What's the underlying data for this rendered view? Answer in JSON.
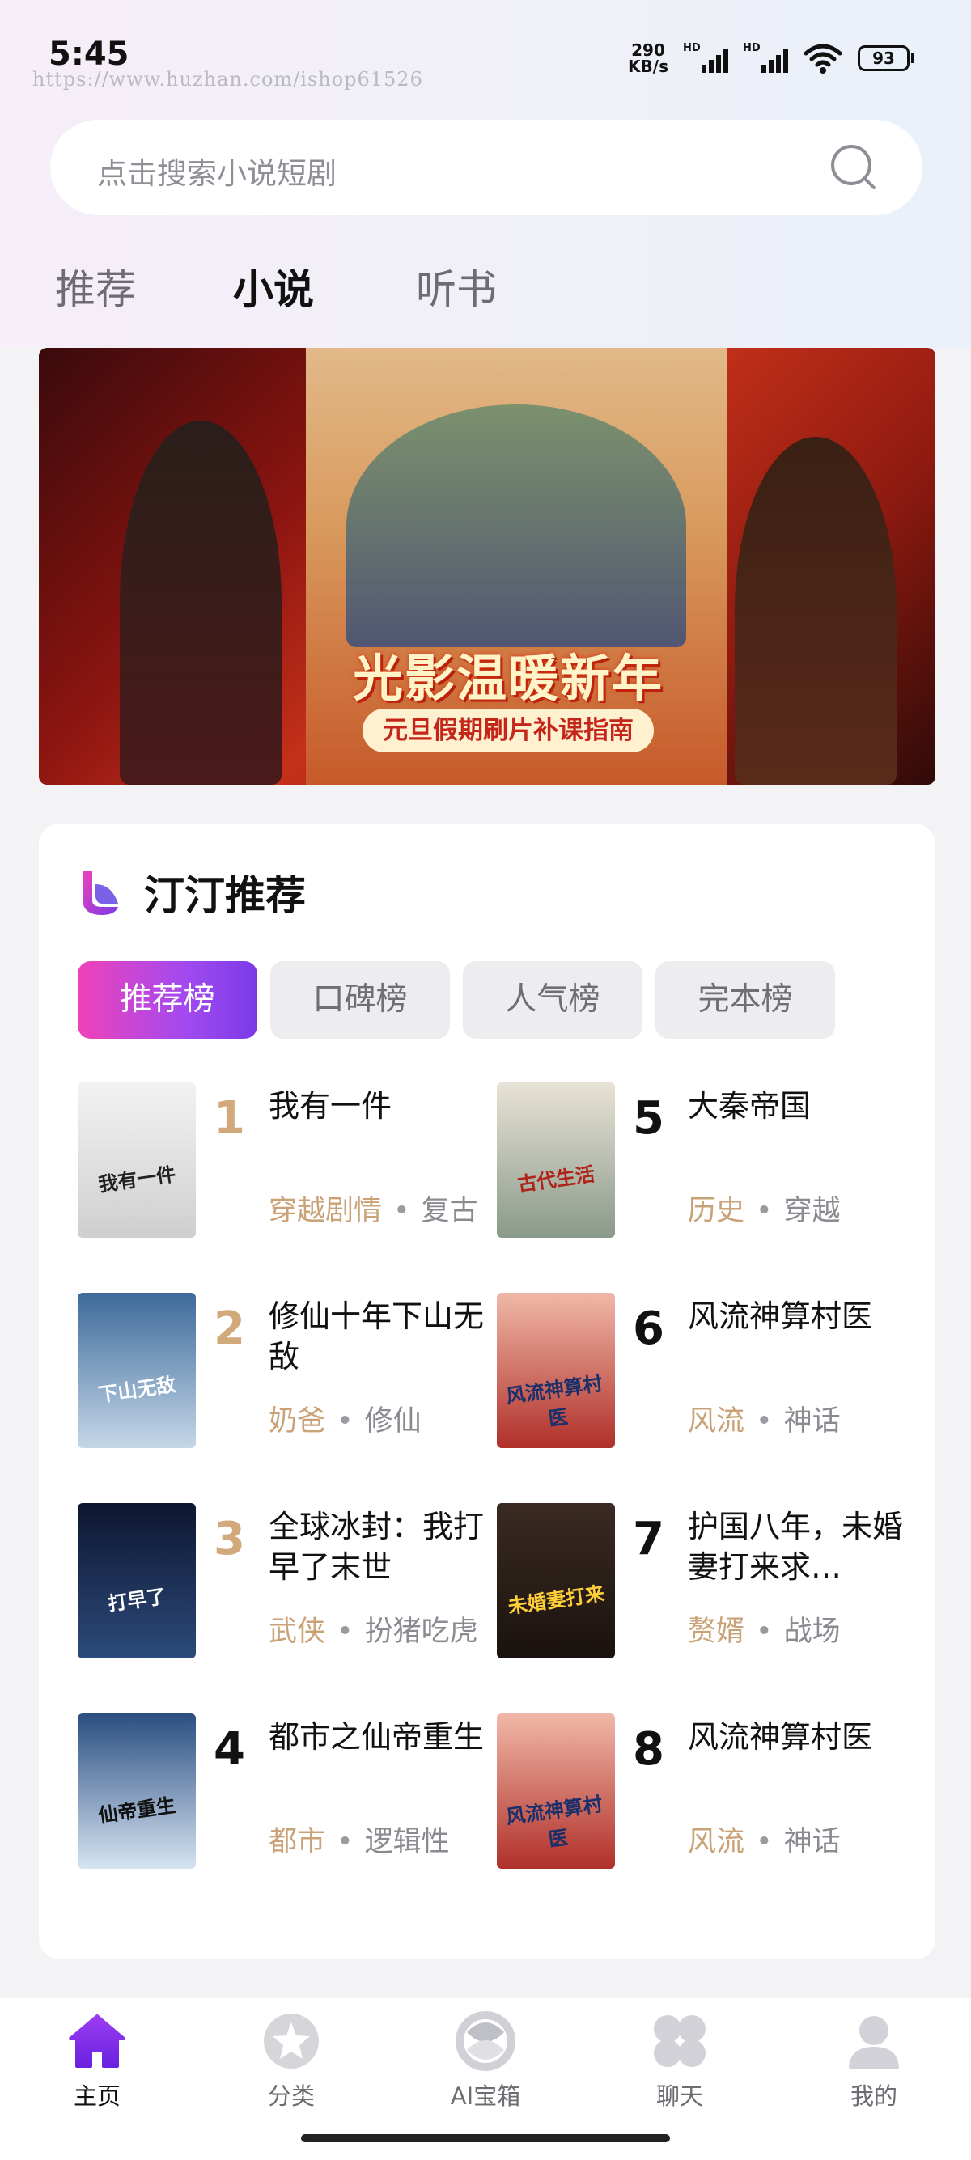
{
  "status_bar": {
    "time": "5:45",
    "watermark": "https://www.huzhan.com/ishop61526",
    "net_speed_value": "290",
    "net_speed_unit": "KB/s",
    "sim1_label": "HD",
    "sim2_label": "HD",
    "battery": "93"
  },
  "search": {
    "placeholder": "点击搜索小说短剧"
  },
  "tabs": [
    {
      "label": "推荐",
      "active": false
    },
    {
      "label": "小说",
      "active": true
    },
    {
      "label": "听书",
      "active": false
    }
  ],
  "banner": {
    "title": "光影温暖新年",
    "subtitle": "元旦假期刷片补课指南"
  },
  "section": {
    "title": "汀汀推荐",
    "rank_tabs": [
      {
        "label": "推荐榜",
        "active": true
      },
      {
        "label": "口碑榜",
        "active": false
      },
      {
        "label": "人气榜",
        "active": false
      },
      {
        "label": "完本榜",
        "active": false
      }
    ],
    "books": [
      {
        "rank": "1",
        "title": "我有一件",
        "tag1": "穿越剧情",
        "tag2": "复古",
        "cover_text": "我有一件",
        "cover_color": "#dcdcdc"
      },
      {
        "rank": "2",
        "title": "修仙十年下山无敌",
        "tag1": "奶爸",
        "tag2": "修仙",
        "cover_text": "下山无敌",
        "cover_color": "#6b8fb3"
      },
      {
        "rank": "3",
        "title": "全球冰封：我打早了末世",
        "tag1": "武侠",
        "tag2": "扮猪吃虎",
        "cover_text": "打早了",
        "cover_color": "#1b2a4a"
      },
      {
        "rank": "4",
        "title": "都市之仙帝重生",
        "tag1": "都市",
        "tag2": "逻辑性",
        "cover_text": "仙帝重生",
        "cover_color": "#9fb7d4"
      },
      {
        "rank": "5",
        "title": "大秦帝国",
        "tag1": "历史",
        "tag2": "穿越",
        "cover_text": "古代生活",
        "cover_color": "#c9b9a0"
      },
      {
        "rank": "6",
        "title": "风流神算村医",
        "tag1": "风流",
        "tag2": "神话",
        "cover_text": "风流神算村医",
        "cover_color": "#d26a62"
      },
      {
        "rank": "7",
        "title": "护国八年，未婚妻打来求…",
        "tag1": "赘婿",
        "tag2": "战场",
        "cover_text": "未婚妻打来",
        "cover_color": "#5a3a2a"
      },
      {
        "rank": "8",
        "title": "风流神算村医",
        "tag1": "风流",
        "tag2": "神话",
        "cover_text": "风流神算村医",
        "cover_color": "#d26a62"
      }
    ]
  },
  "bottom_nav": [
    {
      "label": "主页",
      "icon": "home-icon",
      "active": true
    },
    {
      "label": "分类",
      "icon": "category-icon",
      "active": false
    },
    {
      "label": "AI宝箱",
      "icon": "ai-box-icon",
      "active": false
    },
    {
      "label": "聊天",
      "icon": "chat-icon",
      "active": false
    },
    {
      "label": "我的",
      "icon": "profile-icon",
      "active": false
    }
  ],
  "colors": {
    "accent_start": "#ef42b8",
    "accent_end": "#7a3ae8",
    "rank_gold": "#d2a97a",
    "tag_gold": "#c9a277",
    "nav_active": "#7b2ff0"
  }
}
